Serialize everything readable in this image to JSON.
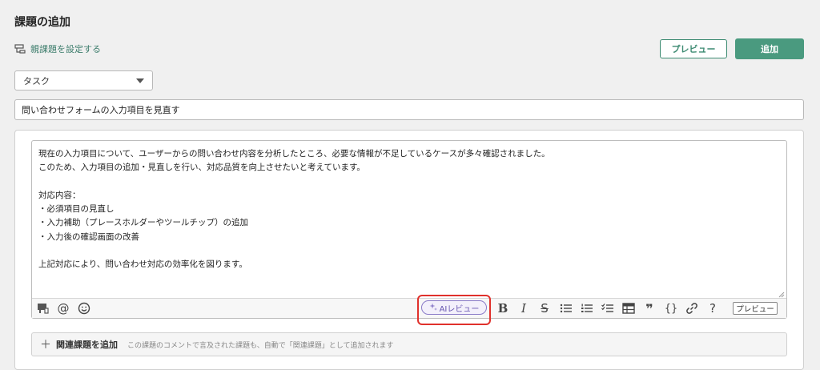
{
  "header": {
    "title": "課題の追加",
    "parent_link": "親課題を設定する",
    "preview_button": "プレビュー",
    "add_button": "追加"
  },
  "form": {
    "issue_type": "タスク",
    "summary": "問い合わせフォームの入力項目を見直す",
    "description": "現在の入力項目について、ユーザーからの問い合わせ内容を分析したところ、必要な情報が不足しているケースが多々確認されました。\nこのため、入力項目の追加・見直しを行い、対応品質を向上させたいと考えています。\n\n対応内容：\n・必須項目の見直し\n・入力補助（プレースホルダーやツールチップ）の追加\n・入力後の確認画面の改善\n\n上記対応により、問い合わせ対応の効率化を図ります。"
  },
  "toolbar": {
    "ai_review": "AIレビュー",
    "preview": "プレビュー",
    "bold": "B",
    "italic": "I",
    "strike": "S",
    "quote": "❞",
    "code": "{}",
    "help": "?",
    "mention": "@",
    "icons": [
      "attachment-icon",
      "mention-icon",
      "emoji-icon",
      "sparkle-icon",
      "bold-icon",
      "italic-icon",
      "strikethrough-icon",
      "bullet-list-icon",
      "numbered-list-icon",
      "checklist-icon",
      "table-icon",
      "quote-icon",
      "code-icon",
      "link-icon",
      "help-icon"
    ]
  },
  "related": {
    "label": "関連課題を追加",
    "description": "この課題のコメントで言及された課題も、自動で「関連課題」として追加されます"
  },
  "colors": {
    "accent": "#4a9a7f",
    "link": "#3d7d6c",
    "ai": "#6654b0",
    "highlight": "#e0312c"
  }
}
